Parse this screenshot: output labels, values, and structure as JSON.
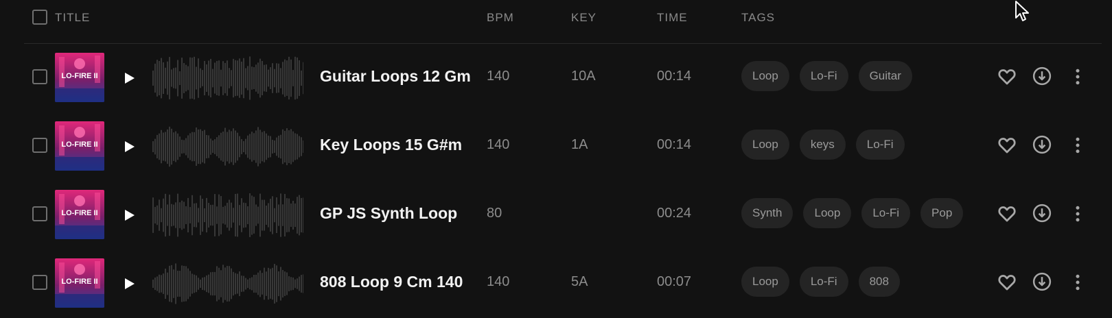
{
  "header": {
    "title": "TITLE",
    "bpm": "BPM",
    "key": "KEY",
    "time": "TIME",
    "tags": "TAGS"
  },
  "rows": [
    {
      "art_text": "LO-FIRE II",
      "title": "Guitar Loops 12 Gm",
      "bpm": "140",
      "key": "10A",
      "time": "00:14",
      "tags": [
        "Loop",
        "Lo-Fi",
        "Guitar"
      ]
    },
    {
      "art_text": "LO-FIRE II",
      "title": "Key Loops 15 G#m",
      "bpm": "140",
      "key": "1A",
      "time": "00:14",
      "tags": [
        "Loop",
        "keys",
        "Lo-Fi"
      ]
    },
    {
      "art_text": "LO-FIRE II",
      "title": "GP JS Synth Loop",
      "bpm": "80",
      "key": "",
      "time": "00:24",
      "tags": [
        "Synth",
        "Loop",
        "Lo-Fi",
        "Pop"
      ]
    },
    {
      "art_text": "LO-FIRE II",
      "title": "808 Loop 9 Cm 140",
      "bpm": "140",
      "key": "5A",
      "time": "00:07",
      "tags": [
        "Loop",
        "Lo-Fi",
        "808"
      ]
    }
  ],
  "icons": {
    "select_all": "checkbox-icon",
    "play": "play-icon",
    "favorite": "heart-icon",
    "download": "download-icon",
    "more": "more-vertical-icon",
    "cursor": "cursor-icon"
  },
  "colors": {
    "background": "#121212",
    "tag_bg": "#242424",
    "muted_text": "#8c8c8c",
    "title_text": "#f2f2f2",
    "art_pink": "#e0287a",
    "art_blue": "#2b3f9c"
  }
}
